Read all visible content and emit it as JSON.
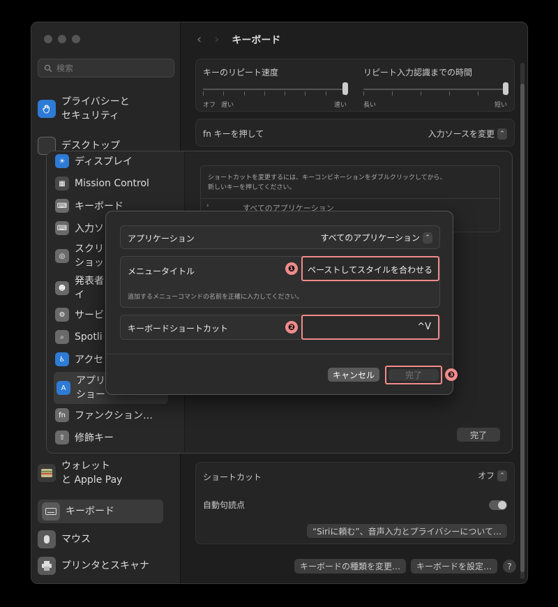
{
  "window": {
    "title": "キーボード"
  },
  "sidebar": {
    "search_placeholder": "検索",
    "items": [
      {
        "label": "プライバシーと\nセキュリティ",
        "icon": "hand-icon"
      },
      {
        "label": "デスクトップ",
        "icon": "desktop-icon"
      },
      {
        "label": "ウォレット\nと Apple Pay",
        "icon": "wallet-icon"
      },
      {
        "label": "キーボード",
        "icon": "keyboard-icon"
      },
      {
        "label": "マウス",
        "icon": "mouse-icon"
      },
      {
        "label": "プリンタとスキャナ",
        "icon": "printer-icon"
      }
    ]
  },
  "keyboard": {
    "repeat_speed_label": "キーのリピート速度",
    "repeat_delay_label": "リピート入力認識までの時間",
    "speed_min": "オフ",
    "speed_slow": "遅い",
    "speed_fast": "速い",
    "delay_long": "長い",
    "delay_short": "短い",
    "fn_label": "fn キーを押して",
    "fn_value": "入力ソースを変更",
    "shortcut_label": "ショートカット",
    "shortcut_value": "オフ",
    "auto_punct_label": "自動句読点",
    "siri_button": "“Siriに頼む”、音声入力とプライバシーについて…",
    "change_type_button": "キーボードの種類を変更…",
    "setup_button": "キーボードを設定…",
    "help": "?"
  },
  "shortcuts_sheet": {
    "items": [
      {
        "label": "ディスプレイ",
        "icon": "display-icon",
        "color": "#2e7bd6"
      },
      {
        "label": "Mission Control",
        "icon": "mission-control-icon",
        "color": "#4a4a4a"
      },
      {
        "label": "キーボード",
        "icon": "keyboard-icon",
        "color": "#6a6a6a"
      },
      {
        "label": "入力ソ",
        "icon": "input-source-icon",
        "color": "#6a6a6a"
      },
      {
        "label": "スクリ\nショッ",
        "icon": "screenshot-icon",
        "color": "#6a6a6a"
      },
      {
        "label": "発表者\nイ",
        "icon": "presenter-icon",
        "color": "#6a6a6a"
      },
      {
        "label": "サービ",
        "icon": "services-icon",
        "color": "#6a6a6a"
      },
      {
        "label": "Spotli",
        "icon": "spotlight-icon",
        "color": "#6a6a6a"
      },
      {
        "label": "アクセ",
        "icon": "accessibility-icon",
        "color": "#2e7bd6"
      },
      {
        "label": "アプリ\nショー",
        "icon": "app-store-icon",
        "color": "#2e7bd6"
      },
      {
        "label": "ファンクション…",
        "icon": "fn-icon",
        "color": "#6a6a6a"
      },
      {
        "label": "修飾キー",
        "icon": "modifier-icon",
        "color": "#6a6a6a"
      }
    ],
    "info_text": "ショートカットを変更するには、キーコンビネーションをダブルクリックしてから、\n新しいキーを押してください。",
    "row_label": "すべてのアプリケーション",
    "done_button": "完了"
  },
  "dialog": {
    "app_label": "アプリケーション",
    "app_value": "すべてのアプリケーション",
    "menu_title_label": "メニュータイトル",
    "menu_title_value": "ペーストしてスタイルを合わせる",
    "hint": "追加するメニューコマンドの名前を正確に入力してください。",
    "shortcut_label": "キーボードショートカット",
    "shortcut_value": "^V",
    "cancel_button": "キャンセル",
    "done_button": "完了",
    "callouts": [
      "❶",
      "❷",
      "❸"
    ],
    "accent_color": "#f28b8b"
  }
}
